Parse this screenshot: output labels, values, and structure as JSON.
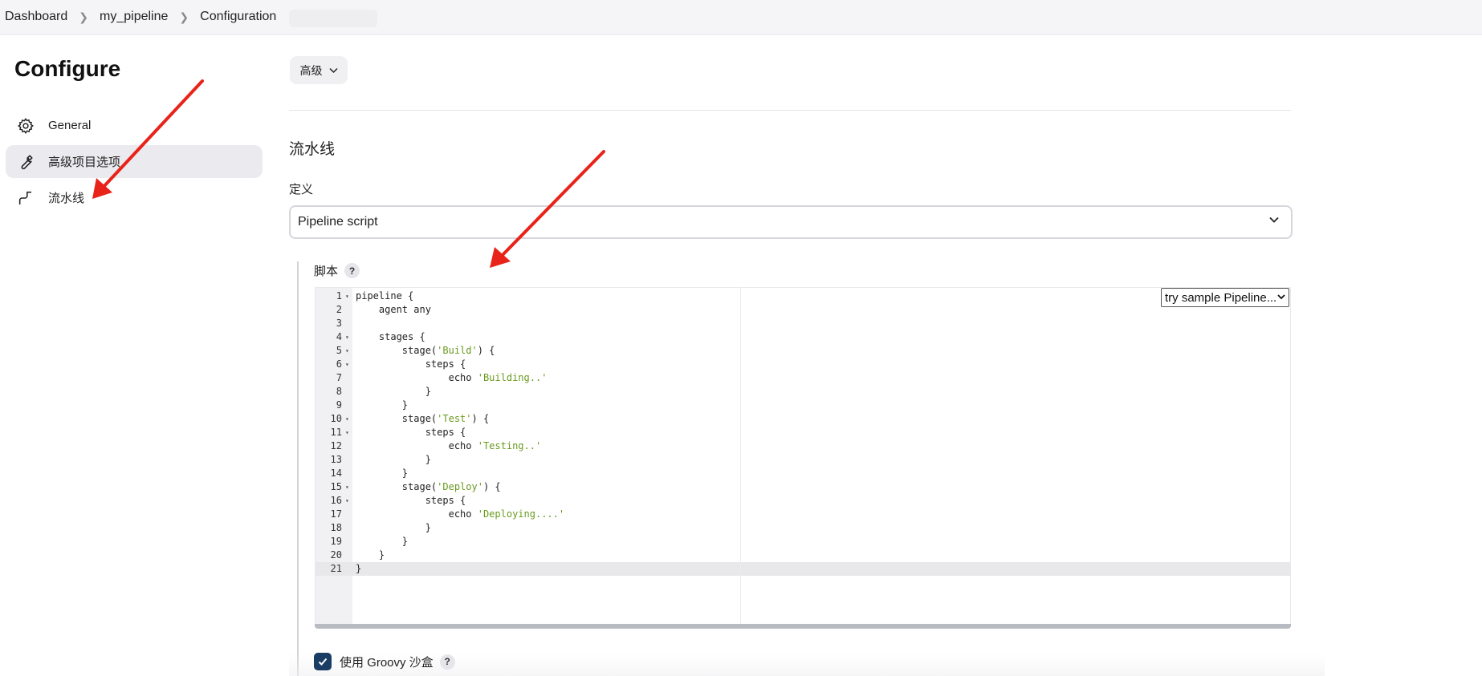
{
  "breadcrumb": {
    "items": [
      "Dashboard",
      "my_pipeline",
      "Configuration"
    ]
  },
  "sidebar": {
    "title": "Configure",
    "items": [
      {
        "label": "General",
        "icon": "gear-icon"
      },
      {
        "label": "高级项目选项",
        "icon": "wrench-icon",
        "active": true
      },
      {
        "label": "流水线",
        "icon": "pipeline-icon"
      }
    ]
  },
  "main": {
    "advanced_button": "高级",
    "section_title": "流水线",
    "definition_label": "定义",
    "definition_value": "Pipeline script",
    "script_label": "脚本",
    "help_glyph": "?",
    "sample_select": "try sample Pipeline...",
    "groovy_sandbox_label": "使用 Groovy 沙盒",
    "groovy_sandbox_checked": true
  },
  "editor": {
    "current_line": 21,
    "lines": [
      "pipeline {",
      "    agent any",
      "",
      "    stages {",
      "        stage('Build') {",
      "            steps {",
      "                echo 'Building..'",
      "            }",
      "        }",
      "        stage('Test') {",
      "            steps {",
      "                echo 'Testing..'",
      "            }",
      "        }",
      "        stage('Deploy') {",
      "            steps {",
      "                echo 'Deploying....'",
      "            }",
      "        }",
      "    }",
      "}"
    ],
    "fold_lines": [
      1,
      4,
      5,
      6,
      10,
      11,
      15,
      16
    ]
  },
  "colors": {
    "annotation_arrow": "#e8231a",
    "checkbox": "#1b3d63",
    "string_literal": "#6a9a1f",
    "active_sidebar": "#ebebef"
  }
}
